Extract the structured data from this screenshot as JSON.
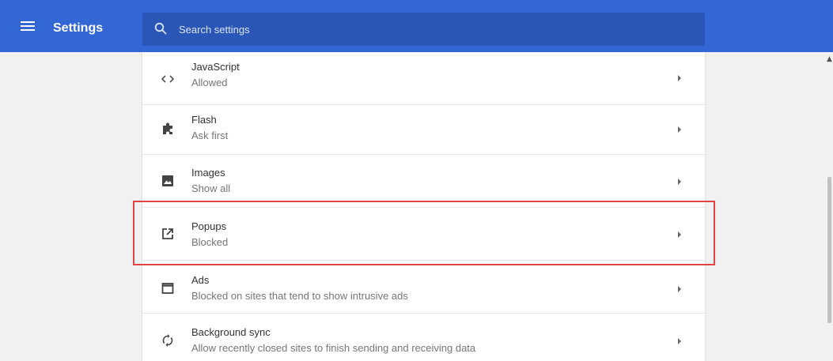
{
  "header": {
    "title": "Settings",
    "menu_icon": "hamburger-menu-icon",
    "search": {
      "icon": "search-icon",
      "placeholder": "Search settings",
      "value": ""
    },
    "colors": {
      "bar": "#3367d6",
      "search_bg": "#2a56b8"
    }
  },
  "content_settings": {
    "items": [
      {
        "title": "JavaScript",
        "subtitle": "Allowed",
        "icon": "code-brackets-icon"
      },
      {
        "title": "Flash",
        "subtitle": "Ask first",
        "icon": "puzzle-piece-icon"
      },
      {
        "title": "Images",
        "subtitle": "Show all",
        "icon": "image-icon"
      },
      {
        "title": "Popups",
        "subtitle": "Blocked",
        "icon": "open-in-new-icon",
        "highlighted": true
      },
      {
        "title": "Ads",
        "subtitle": "Blocked on sites that tend to show intrusive ads",
        "icon": "window-icon"
      },
      {
        "title": "Background sync",
        "subtitle": "Allow recently closed sites to finish sending and receiving data",
        "icon": "sync-icon"
      }
    ]
  },
  "highlight_color": "#e04444"
}
